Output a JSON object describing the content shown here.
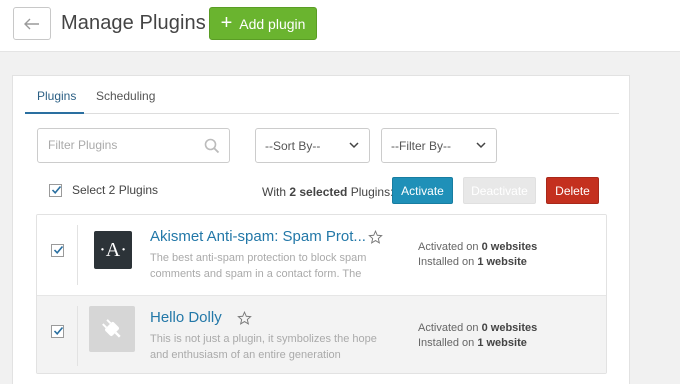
{
  "header": {
    "title": "Manage Plugins",
    "add_button_label": "Add plugin"
  },
  "tabs": [
    {
      "label": "Plugins",
      "active": true
    },
    {
      "label": "Scheduling",
      "active": false
    }
  ],
  "filters": {
    "search_placeholder": "Filter Plugins",
    "sort_label": "--Sort By--",
    "filter_label": "--Filter By--"
  },
  "bulk": {
    "select_all_label": "Select 2 Plugins",
    "selected_prefix": "With ",
    "selected_count": "2 selected",
    "selected_suffix": " Plugins:",
    "activate_label": "Activate",
    "deactivate_label": "Deactivate",
    "delete_label": "Delete"
  },
  "plugins": [
    {
      "name": "Akismet Anti-spam: Spam Prot...",
      "description": "The best anti-spam protection to block spam comments and spam in a contact form. The most",
      "icon_text": "·A·",
      "checked": true,
      "activated_prefix": "Activated on ",
      "activated_count": "0 websites",
      "installed_prefix": "Installed on ",
      "installed_count": "1 website"
    },
    {
      "name": "Hello Dolly",
      "description": "This is not just a plugin, it symbolizes the hope and enthusiasm of an entire generation summed up in",
      "icon": "plug-icon",
      "checked": true,
      "activated_prefix": "Activated on ",
      "activated_count": "0 websites",
      "installed_prefix": "Installed on ",
      "installed_count": "1 website"
    }
  ],
  "colors": {
    "add_button": "#6ab42f",
    "activate_button": "#1f90b8",
    "delete_button": "#c4301f",
    "link": "#2378a8"
  }
}
